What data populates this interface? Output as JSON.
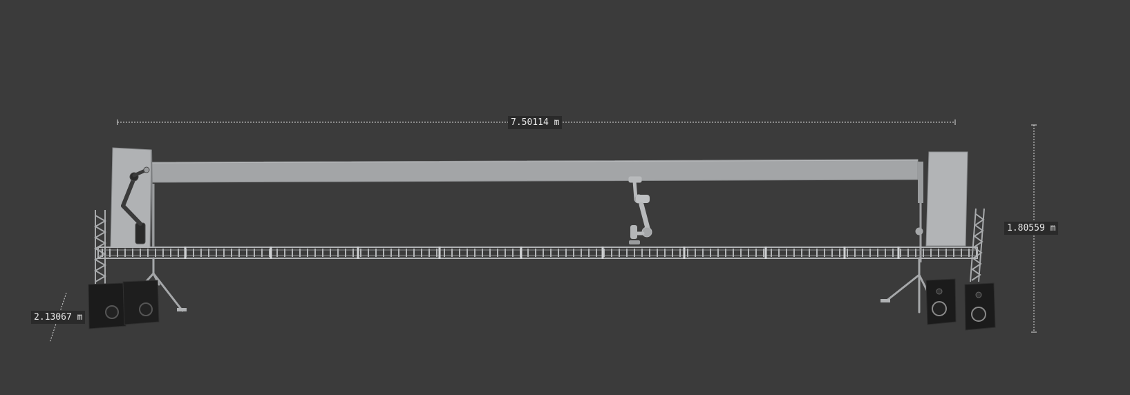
{
  "viewport": {
    "background": "#3b3b3b"
  },
  "dimensions": {
    "width_label": "7.50114 m",
    "height_label": "1.80559 m",
    "depth_label": "2.13067 m"
  },
  "colors": {
    "beam": "#a3a5a7",
    "panel": "#b2b4b6",
    "truss": "#a8aaac",
    "speaker": "#1b1b1b",
    "dimension_line": "#dcdcdc"
  },
  "objects": [
    "overhead-beam",
    "left-panel",
    "right-panel",
    "truss-rail",
    "left-robot-arm",
    "center-robot-arm",
    "left-tripod",
    "right-tripod",
    "speakers"
  ]
}
